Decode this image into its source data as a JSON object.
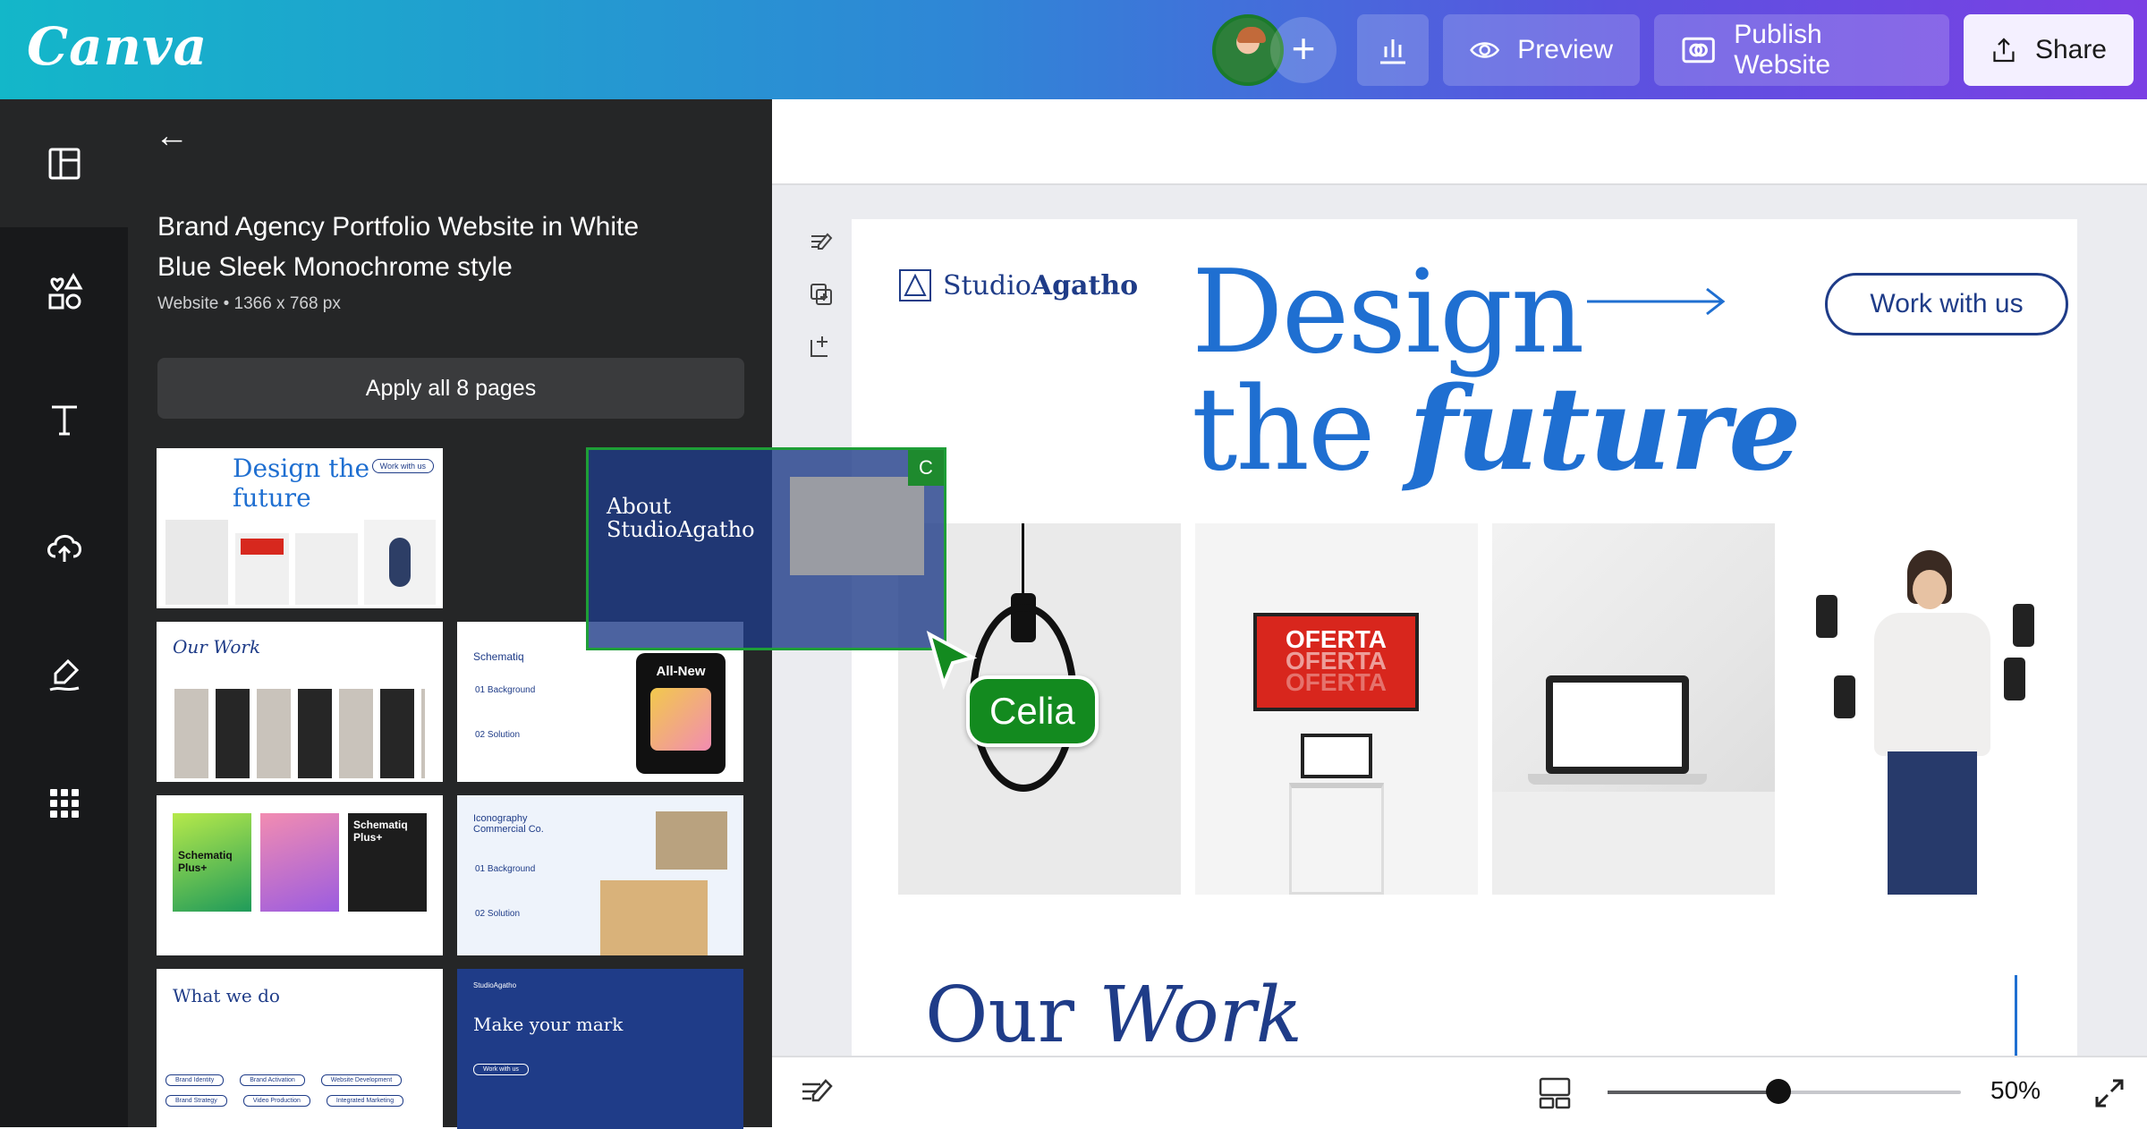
{
  "app": {
    "logo": "Canva"
  },
  "topbar": {
    "add_label": "+",
    "preview_label": "Preview",
    "publish_label": "Publish Website",
    "share_label": "Share"
  },
  "sidebar": {
    "items": [
      {
        "icon": "layout-icon"
      },
      {
        "icon": "elements-icon"
      },
      {
        "icon": "text-icon"
      },
      {
        "icon": "upload-icon"
      },
      {
        "icon": "draw-icon"
      },
      {
        "icon": "apps-icon"
      }
    ]
  },
  "panel": {
    "title": "Brand Agency Portfolio Website in White Blue Sleek Monochrome style",
    "meta": "Website • 1366 x 768 px",
    "apply_label": "Apply all 8 pages",
    "thumbnails": [
      {
        "title": "Design the future",
        "btn": "Work with us"
      },
      {
        "title": "About StudioAgatho"
      },
      {
        "title": "Our Work"
      },
      {
        "title": "Schematiq",
        "sub": "All-New",
        "labels": [
          "01",
          "Background",
          "02",
          "Solution"
        ]
      },
      {
        "title": "Schematiq Plus+",
        "sub": "Schematiq Plus+"
      },
      {
        "title": "Iconography Commercial Co.",
        "labels": [
          "01",
          "Background",
          "02",
          "Solution"
        ]
      },
      {
        "title": "What we do",
        "chips": [
          "Brand Identity",
          "Brand Activation",
          "Website Development",
          "Brand Strategy",
          "Video Production",
          "Integrated Marketing"
        ]
      },
      {
        "title": "Make your mark",
        "btn": "Work with us",
        "logo": "StudioAgatho"
      }
    ]
  },
  "drag": {
    "title_line1": "About",
    "title_line2": "StudioAgatho",
    "badge": "C"
  },
  "collaborator": {
    "name": "Celia"
  },
  "page": {
    "logo_regular": "Studio",
    "logo_bold": "Agatho",
    "headline_line1": "Design",
    "headline_the": "the ",
    "headline_future": "future",
    "cta": "Work with us",
    "oferta": [
      "OFERTA",
      "OFERTA",
      "OFERTA"
    ],
    "section_title_regular": "Our ",
    "section_title_italic": "Work"
  },
  "bottombar": {
    "zoom": "50%",
    "zoom_fraction": 0.5
  },
  "colors": {
    "accent": "#1f6fd1",
    "navy": "#1f3c88",
    "collab": "#138a1f"
  }
}
